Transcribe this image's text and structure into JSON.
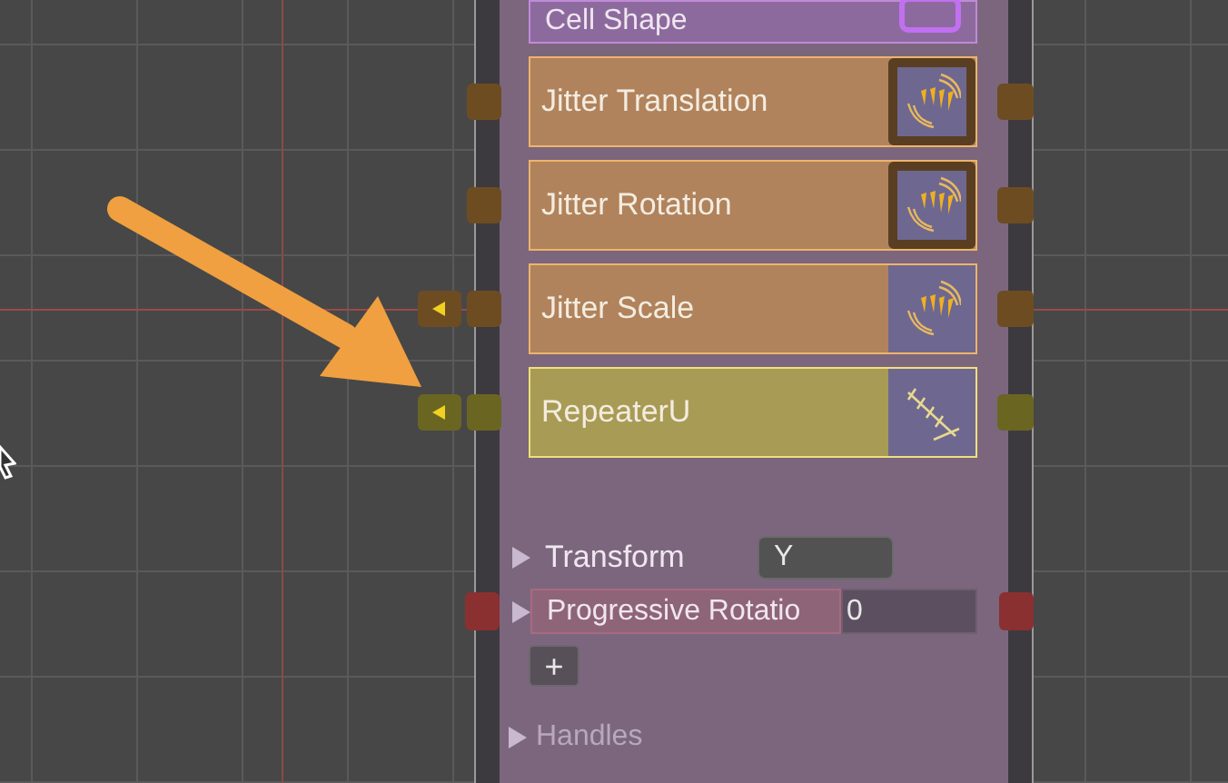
{
  "node": {
    "rows": [
      {
        "kind": "shape",
        "label": "Cell Shape",
        "color": "#8d6a9e"
      },
      {
        "kind": "jitter",
        "label": "Jitter Translation",
        "color": "#b0835c",
        "framed": true,
        "input_arrow": false
      },
      {
        "kind": "jitter",
        "label": "Jitter Rotation",
        "color": "#b0835c",
        "framed": true,
        "input_arrow": false
      },
      {
        "kind": "jitter",
        "label": "Jitter Scale",
        "color": "#b0835c",
        "framed": false,
        "input_arrow": true
      },
      {
        "kind": "repeater",
        "label": "RepeaterU",
        "color": "#a89b55",
        "framed": false,
        "input_arrow": true
      }
    ],
    "properties": [
      {
        "kind": "dropdown",
        "label": "Transform",
        "value": "Y",
        "expanded": false,
        "highlighted": false
      },
      {
        "kind": "number",
        "label": "Progressive Rotatio",
        "value": "0",
        "expanded": false,
        "highlighted": true
      }
    ],
    "add_button": "+",
    "sections": [
      {
        "label": "Handles",
        "expanded": false
      }
    ]
  }
}
